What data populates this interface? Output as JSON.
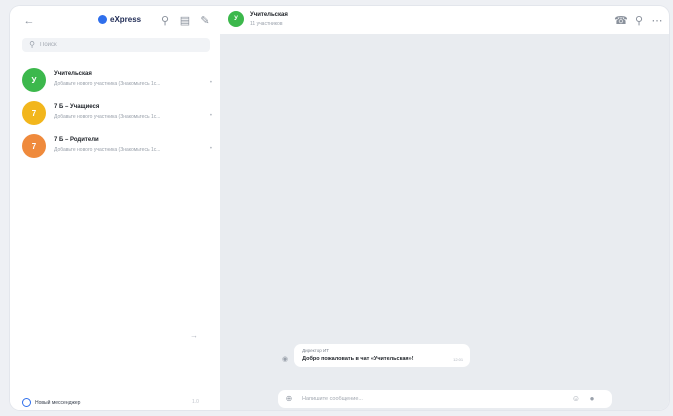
{
  "sidebar": {
    "logo_text": "eXpress",
    "search_placeholder": "Поиск",
    "chats": [
      {
        "title": "Учительская",
        "subtitle": "Добавьте нового участника (Знакомьтесь 1с...",
        "initial": "У",
        "color": "#3cb84c"
      },
      {
        "title": "7 Б – Учащиеся",
        "subtitle": "Добавьте нового участника (Знакомьтесь 1с...",
        "initial": "7",
        "color": "#f2b61c"
      },
      {
        "title": "7 Б – Родители",
        "subtitle": "Добавьте нового участника (Знакомьтесь 1с...",
        "initial": "7",
        "color": "#ef8a3c"
      }
    ],
    "footer_label": "Новый мессенджер",
    "footer_hint": "1.0"
  },
  "conversation": {
    "title": "Учительская",
    "subtitle": "11 участников",
    "initial": "У",
    "message": {
      "author": "Директор ИТ",
      "text": "Добро пожаловать в чат «Учительская»!",
      "time": "12:01"
    },
    "composer_placeholder": "Напишите сообщение..."
  },
  "colors": {
    "accent": "#2f6fec",
    "chat_background": "#e9ecf0"
  }
}
